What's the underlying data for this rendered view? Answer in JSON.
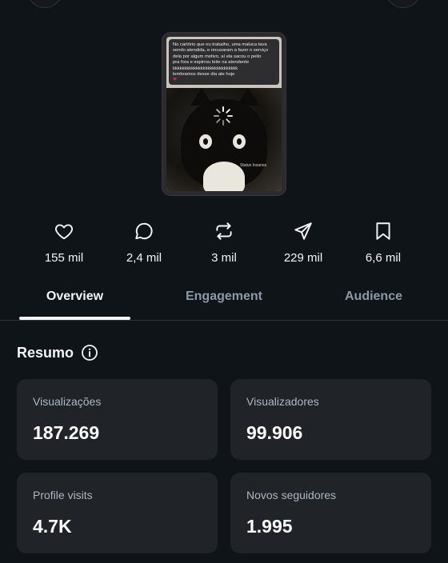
{
  "post": {
    "caption_lines": [
      "No cartório que eu trabalho, uma maluca tava",
      "sendo atendida, e recusaram a fazer o serviço",
      "dela por algum motivo, aí ela sacou o peito",
      "pra fora e espirrou leite na atendente",
      "kkkkkkkkkkkkkkkkkkkkkkkkkkkk",
      "lembramos desse dia ate hoje"
    ],
    "watermark": "Status Insanos"
  },
  "stats": {
    "likes": "155 mil",
    "replies": "2,4 mil",
    "reposts": "3 mil",
    "shares": "229 mil",
    "bookmarks": "6,6 mil"
  },
  "tabs": [
    {
      "label": "Overview",
      "active": true
    },
    {
      "label": "Engagement",
      "active": false
    },
    {
      "label": "Audience",
      "active": false
    }
  ],
  "summary": {
    "title": "Resumo",
    "cards": [
      {
        "label": "Visualizações",
        "value": "187.269"
      },
      {
        "label": "Visualizadores",
        "value": "99.906"
      },
      {
        "label": "Profile visits",
        "value": "4.7K"
      },
      {
        "label": "Novos seguidores",
        "value": "1.995"
      }
    ]
  },
  "icons": {
    "likes": "heart-icon",
    "replies": "reply-bubble-icon",
    "reposts": "repost-icon",
    "shares": "share-send-icon",
    "bookmarks": "bookmark-icon",
    "info": "info-icon"
  },
  "colors": {
    "background": "#0f1419",
    "card": "#202327",
    "text_primary": "#f3f5f7",
    "text_secondary": "#8b98a5"
  }
}
